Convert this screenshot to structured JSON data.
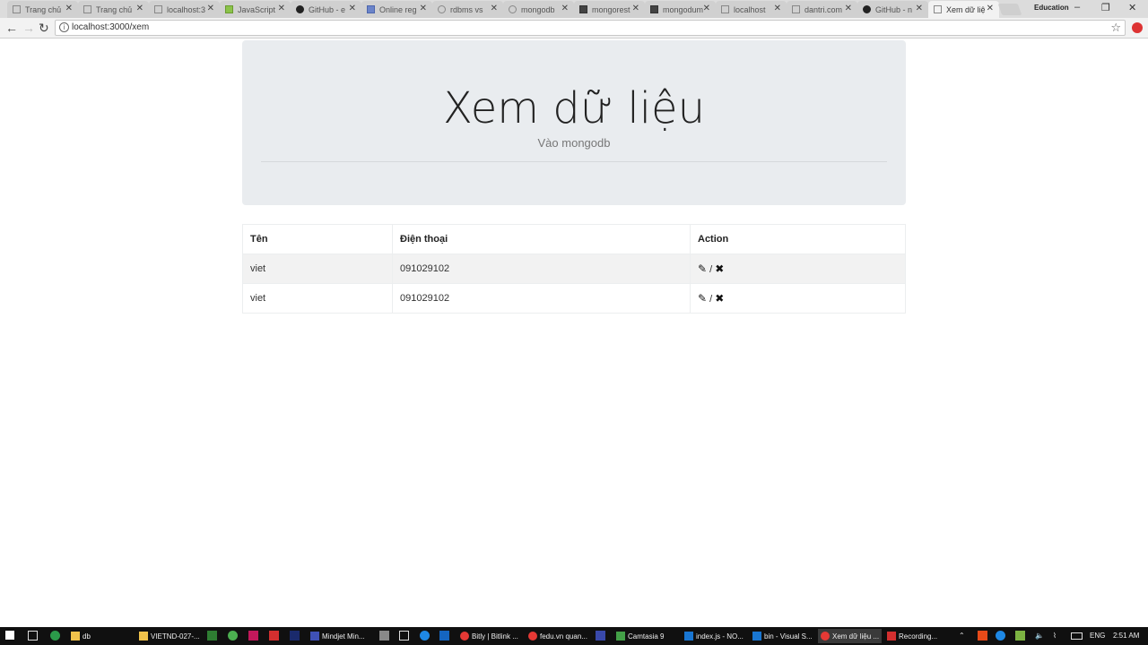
{
  "browser": {
    "tabs": [
      {
        "label": "Trang chủ",
        "active": false
      },
      {
        "label": "Trang chủ",
        "active": false
      },
      {
        "label": "localhost:3",
        "active": false
      },
      {
        "label": "JavaScript",
        "active": false
      },
      {
        "label": "GitHub - e",
        "active": false
      },
      {
        "label": "Online reg",
        "active": false
      },
      {
        "label": "rdbms vs",
        "active": false
      },
      {
        "label": "mongodb",
        "active": false
      },
      {
        "label": "mongorest",
        "active": false
      },
      {
        "label": "mongodum",
        "active": false
      },
      {
        "label": "localhost",
        "active": false
      },
      {
        "label": "dantri.com",
        "active": false
      },
      {
        "label": "GitHub - n",
        "active": false
      },
      {
        "label": "Xem dữ liệ",
        "active": true
      }
    ],
    "profile_name": "Education",
    "address": "localhost:3000/xem"
  },
  "page": {
    "title": "Xem dữ liệu",
    "subtitle": "Vào mongodb",
    "table": {
      "headers": [
        "Tên",
        "Điện thoại",
        "Action"
      ],
      "rows": [
        {
          "name": "viet",
          "phone": "091029102",
          "separator": "/"
        },
        {
          "name": "viet",
          "phone": "091029102",
          "separator": "/"
        }
      ]
    }
  },
  "taskbar": {
    "items": [
      {
        "label": "db"
      },
      {
        "label": "VIETND-027-..."
      },
      {
        "label": "Mindjet Min..."
      },
      {
        "label": "Bitly | Bitlink ..."
      },
      {
        "label": "fedu.vn quan..."
      },
      {
        "label": "Camtasia 9"
      },
      {
        "label": "index.js - NO..."
      },
      {
        "label": "bin - Visual S..."
      },
      {
        "label": "Xem dữ liệu ..."
      },
      {
        "label": "Recording..."
      }
    ],
    "language": "ENG",
    "time": "2:51 AM"
  }
}
